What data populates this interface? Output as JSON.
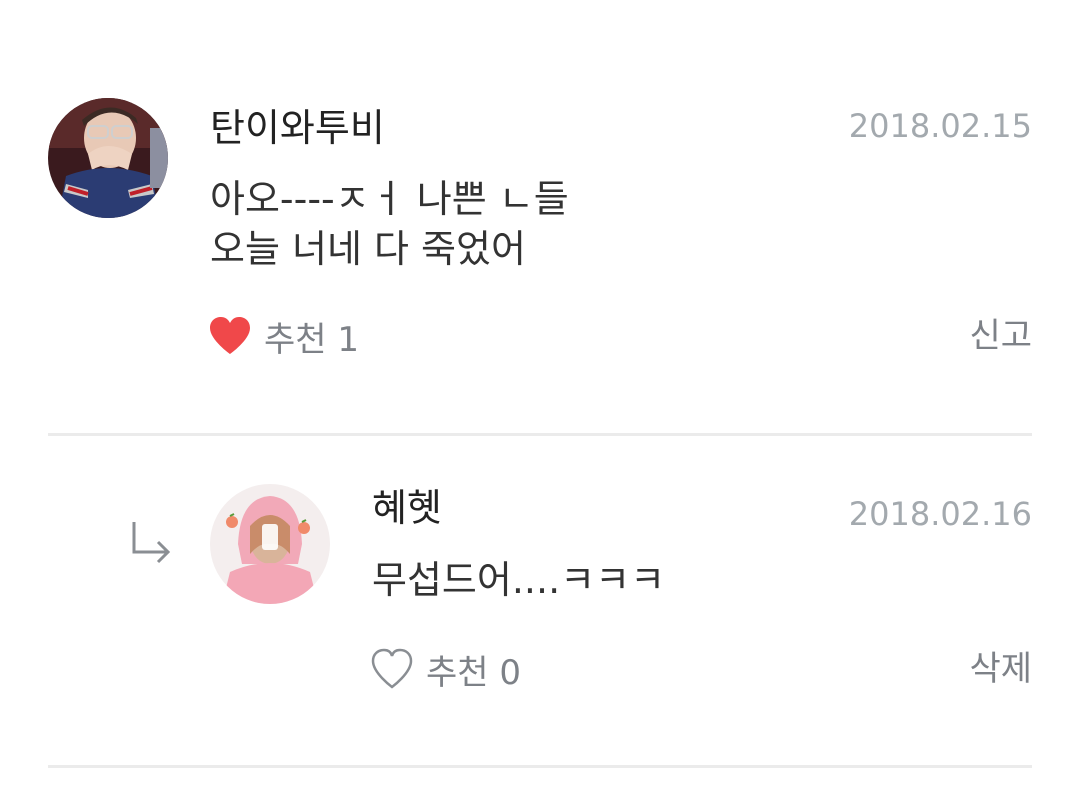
{
  "comments": [
    {
      "username": "탄이와투비",
      "date": "2018.02.15",
      "text": "아오----ㅈㅓ 나쁜 ㄴ들\n오늘 너네 다 죽었어",
      "like_label": "추천 1",
      "liked": true,
      "action": "신고",
      "avatar_icon": "avatar-photo-man-glasses"
    },
    {
      "username": "혜혯",
      "date": "2018.02.16",
      "text": "무섭드어....ㅋㅋㅋ",
      "like_label": "추천 0",
      "liked": false,
      "action": "삭제",
      "is_reply": true,
      "avatar_icon": "avatar-photo-girl-pink-hoodie"
    }
  ],
  "colors": {
    "heart_filled": "#f0484a",
    "heart_outline": "#8a8e93",
    "date": "#a3a9ae",
    "meta": "#7d8187",
    "divider": "#ebebeb"
  }
}
